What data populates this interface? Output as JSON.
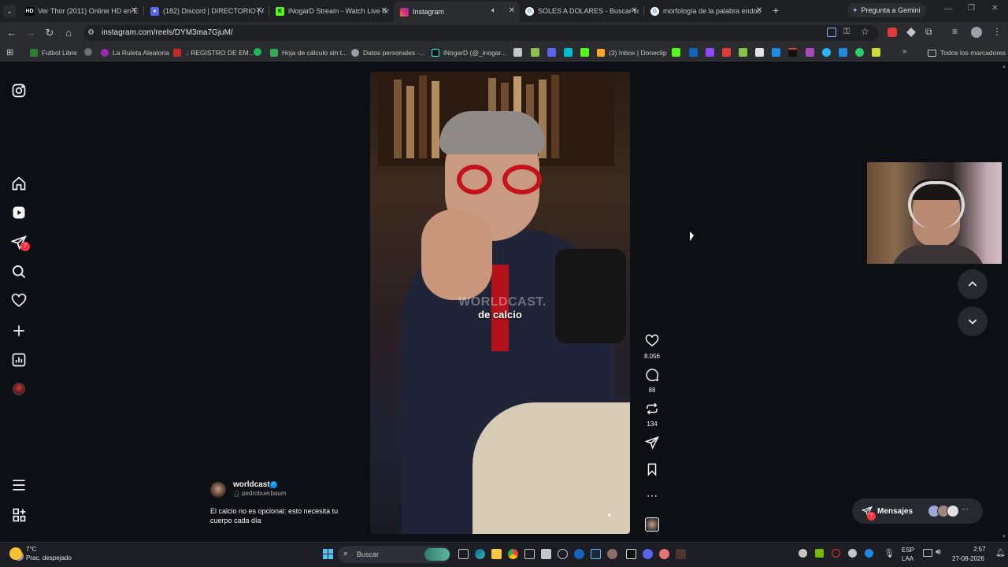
{
  "browser": {
    "tabs": [
      {
        "title": "Ver Thor (2011) Online HD en Español",
        "favicon": "HD",
        "color": "#1f2023"
      },
      {
        "title": "(182) Discord | DIRECTORIO | Al",
        "favicon": "D",
        "color": "#5865f2"
      },
      {
        "title": "iNogarD Stream - Watch Live on",
        "favicon": "K",
        "color": "#53fc18"
      },
      {
        "title": "Instagram",
        "favicon": "",
        "color": "#dd2a7b",
        "active": true
      },
      {
        "title": "SOLES A DOLARES - Buscar con",
        "favicon": "G",
        "color": "#4285f4"
      },
      {
        "title": "morfología de la palabra endoc",
        "favicon": "G",
        "color": "#4285f4"
      }
    ],
    "gemini_label": "Pregunta a Gemini",
    "url": "instagram.com/reels/DYM3ma7GjuM/",
    "bookmarks": [
      {
        "label": "Futbol Libre",
        "color": "#2e7d32"
      },
      {
        "label": "La Ruleta Aleatoria",
        "color": "#9c27b0"
      },
      {
        "label": ".: REGISTRO DE EM...",
        "color": "#c62828"
      },
      {
        "label": "Hoja de cálculo sin t...",
        "color": "#34a853"
      },
      {
        "label": "Datos personales -...",
        "color": "#9aa0a6"
      },
      {
        "label": "iNogarD (@_inogar...",
        "color": "#111111"
      }
    ],
    "all_bookmarks_label": "Todos los marcadores"
  },
  "sidebar": {
    "items": [
      {
        "name": "instagram-logo-icon"
      },
      {
        "name": "home-icon"
      },
      {
        "name": "reels-icon"
      },
      {
        "name": "messages-icon",
        "badge": "7"
      },
      {
        "name": "search-icon"
      },
      {
        "name": "notifications-heart-icon"
      },
      {
        "name": "create-plus-icon"
      },
      {
        "name": "dashboard-icon"
      },
      {
        "name": "profile-avatar"
      },
      {
        "name": "menu-icon"
      },
      {
        "name": "more-apps-icon"
      }
    ]
  },
  "reel": {
    "caption_overlay": "de calcio",
    "watermark": "WORLDCAST.",
    "author": "worldcast_",
    "audio_credit": "pedrobuerbaum",
    "description": "El calcio no es opcional: esto necesita tu cuerpo cada día",
    "likes": "8.056",
    "comments": "88",
    "reposts": "134"
  },
  "messages": {
    "label": "Mensajes",
    "badge": "7"
  },
  "taskbar": {
    "weather_temp": "7°C",
    "weather_desc": "Prac. despejado",
    "search_placeholder": "Buscar",
    "lang_top": "ESP",
    "lang_bottom": "LAA",
    "time": "2:57",
    "date": "27-08-2026"
  }
}
